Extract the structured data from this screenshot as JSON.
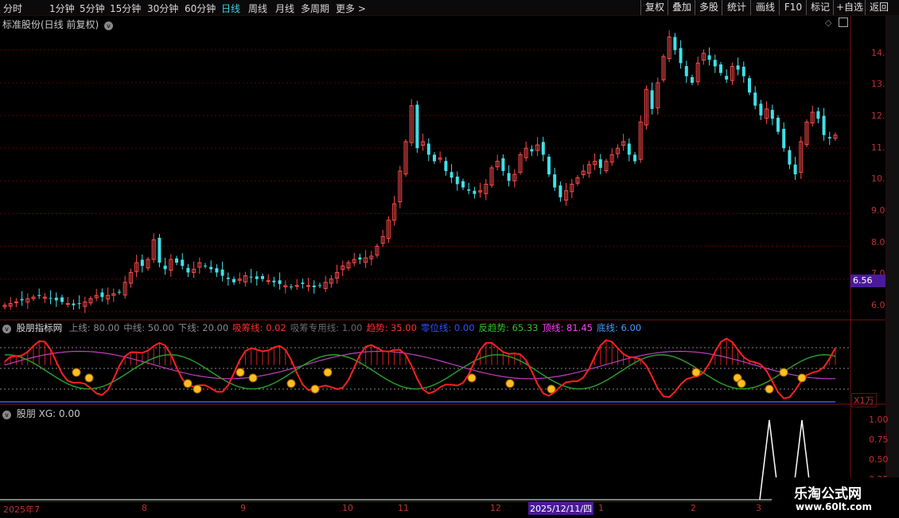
{
  "toolbar": {
    "periods": [
      "分时",
      "1分钟",
      "5分钟",
      "15分钟",
      "30分钟",
      "60分钟",
      "日线",
      "周线",
      "月线",
      "多周期",
      "更多"
    ],
    "active_period": "日线",
    "right_buttons": [
      "复权",
      "叠加",
      "多股",
      "统计",
      "画线",
      "F10",
      "标记",
      "+自选",
      "返回"
    ]
  },
  "price_panel": {
    "title": "标准股份(日线 前复权)",
    "axis_labels": [
      "14.00",
      "13.00",
      "12.00",
      "11.00",
      "10.00",
      "9.00",
      "8.00",
      "7.00",
      "6.00"
    ],
    "current_price": "6.56"
  },
  "indicator1": {
    "name": "股朋指标网",
    "params": [
      {
        "label": "上线: 80.00",
        "color": "#8a8a8a"
      },
      {
        "label": "中线: 50.00",
        "color": "#8a8a8a"
      },
      {
        "label": "下线: 20.00",
        "color": "#8a8a8a"
      },
      {
        "label": "吸筹线: 0.02",
        "color": "#ff3030"
      },
      {
        "label": "吸筹专用线: 1.00",
        "color": "#6a6a6a"
      },
      {
        "label": "趋势: 35.00",
        "color": "#ff3030"
      },
      {
        "label": "零位线: 0.00",
        "color": "#3050ff"
      },
      {
        "label": "反趋势: 65.33",
        "color": "#30c030"
      },
      {
        "label": "顶线: 81.45",
        "color": "#ff40ff"
      },
      {
        "label": "底线: 6.00",
        "color": "#40a0ff"
      }
    ],
    "unit_label": "X1万"
  },
  "indicator2": {
    "title": "股朋  XG: 0.00",
    "axis_labels": [
      "1.00",
      "0.75",
      "0.50",
      "0.25"
    ]
  },
  "date_axis": {
    "labels": [
      "2025年7",
      "8",
      "9",
      "10",
      "11",
      "12",
      "2025/12/11/四",
      "1",
      "2",
      "3"
    ]
  },
  "watermark": {
    "line1": "乐淘公式网",
    "line2": "www.60lt.com"
  },
  "chart_data": {
    "type": "candlestick",
    "ylim": [
      5.8,
      14.8
    ],
    "close": [
      6.2,
      6.25,
      6.3,
      6.35,
      6.4,
      6.45,
      6.5,
      6.45,
      6.4,
      6.35,
      6.3,
      6.25,
      6.2,
      6.25,
      6.3,
      6.4,
      6.5,
      6.45,
      6.5,
      6.55,
      6.6,
      6.9,
      7.2,
      7.5,
      7.4,
      7.6,
      8.2,
      7.5,
      7.3,
      7.6,
      7.5,
      7.4,
      7.2,
      7.3,
      7.5,
      7.4,
      7.3,
      7.2,
      7.1,
      7.0,
      6.9,
      7.0,
      7.1,
      7.05,
      7.0,
      7.0,
      6.95,
      6.9,
      6.85,
      6.8,
      6.75,
      6.8,
      6.85,
      6.8,
      6.75,
      6.8,
      6.9,
      7.0,
      7.2,
      7.4,
      7.5,
      7.6,
      7.6,
      7.65,
      7.7,
      8.0,
      8.3,
      8.8,
      9.3,
      10.3,
      11.2,
      12.3,
      11.0,
      11.2,
      10.8,
      10.6,
      10.7,
      10.3,
      10.1,
      9.9,
      9.8,
      9.7,
      9.6,
      9.7,
      9.9,
      10.4,
      10.6,
      10.3,
      10.0,
      10.2,
      10.8,
      11.0,
      10.9,
      11.1,
      10.8,
      10.2,
      9.8,
      9.5,
      9.7,
      9.9,
      10.1,
      10.3,
      10.5,
      10.6,
      10.4,
      10.6,
      10.8,
      11.0,
      11.2,
      10.8,
      10.6,
      11.8,
      12.8,
      12.2,
      13.0,
      13.8,
      14.4,
      14.0,
      13.6,
      13.2,
      13.0,
      13.6,
      13.9,
      13.7,
      13.5,
      13.3,
      13.1,
      13.5,
      13.4,
      13.2,
      12.7,
      12.3,
      12.0,
      12.2,
      11.9,
      11.5,
      11.0,
      10.5,
      10.2,
      11.2,
      11.8,
      12.1,
      11.9,
      11.4,
      11.3,
      11.4
    ]
  }
}
